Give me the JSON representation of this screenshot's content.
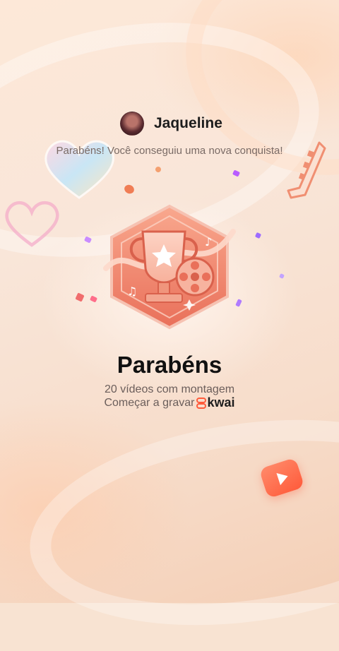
{
  "user": {
    "name": "Jaqueline"
  },
  "subtitle": "Parabéns! Você conseguiu uma nova conquista!",
  "achievement": {
    "title": "Parabéns",
    "description": "20 vídeos com montagem",
    "cta_text": "Começar a gravar",
    "brand": "kwai"
  },
  "colors": {
    "accent": "#ff5b3b",
    "badge_main": "#f07a62",
    "background": "#f8e3d2"
  },
  "icons": {
    "avatar": "user-avatar",
    "badge": "trophy-film-reel-badge",
    "kwai_logo": "kwai-logo-icon",
    "play": "play-icon"
  }
}
